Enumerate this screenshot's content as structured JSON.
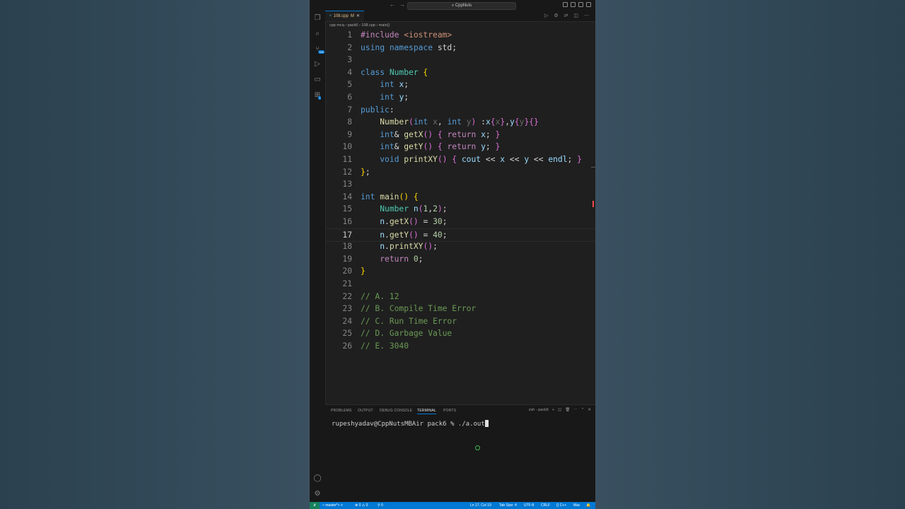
{
  "window": {
    "search_text": "⌕ CppNuts"
  },
  "tab": {
    "filename": "108.cpp",
    "status": "M",
    "close": "✕"
  },
  "breadcrumb": {
    "parts": [
      "cpp mcq",
      "pack6",
      "108.cpp",
      "main()"
    ]
  },
  "editor": {
    "current_line": 17,
    "lines": [
      {
        "num": "1"
      },
      {
        "num": "2"
      },
      {
        "num": "3"
      },
      {
        "num": "4"
      },
      {
        "num": "5"
      },
      {
        "num": "6"
      },
      {
        "num": "7"
      },
      {
        "num": "8"
      },
      {
        "num": "9"
      },
      {
        "num": "10"
      },
      {
        "num": "11"
      },
      {
        "num": "12"
      },
      {
        "num": "13"
      },
      {
        "num": "14"
      },
      {
        "num": "15"
      },
      {
        "num": "16"
      },
      {
        "num": "17"
      },
      {
        "num": "18"
      },
      {
        "num": "19"
      },
      {
        "num": "20"
      },
      {
        "num": "21"
      },
      {
        "num": "22"
      },
      {
        "num": "23"
      },
      {
        "num": "24"
      },
      {
        "num": "25"
      },
      {
        "num": "26"
      }
    ],
    "code": [
      [
        [
          "pre",
          "#include "
        ],
        [
          "s",
          "<iostream>"
        ]
      ],
      [
        [
          "k",
          "using "
        ],
        [
          "k",
          "namespace "
        ],
        [
          "plain",
          "std;"
        ]
      ],
      [],
      [
        [
          "k",
          "class "
        ],
        [
          "t",
          "Number "
        ],
        [
          "b1",
          "{"
        ]
      ],
      [
        [
          "plain",
          "    "
        ],
        [
          "k",
          "int "
        ],
        [
          "v",
          "x"
        ],
        [
          "plain",
          ";"
        ]
      ],
      [
        [
          "plain",
          "    "
        ],
        [
          "k",
          "int "
        ],
        [
          "v",
          "y"
        ],
        [
          "plain",
          ";"
        ]
      ],
      [
        [
          "k",
          "public"
        ],
        [
          "plain",
          ":"
        ]
      ],
      [
        [
          "plain",
          "    "
        ],
        [
          "f",
          "Number"
        ],
        [
          "b2",
          "("
        ],
        [
          "k",
          "int "
        ],
        [
          "dim",
          "x"
        ],
        [
          "plain",
          ", "
        ],
        [
          "k",
          "int "
        ],
        [
          "dim",
          "y"
        ],
        [
          "b2",
          ")"
        ],
        [
          "plain",
          " :"
        ],
        [
          "v",
          "x"
        ],
        [
          "b2",
          "{"
        ],
        [
          "dim",
          "x"
        ],
        [
          "b2",
          "}"
        ],
        [
          "plain",
          ","
        ],
        [
          "v",
          "y"
        ],
        [
          "b2",
          "{"
        ],
        [
          "dim",
          "y"
        ],
        [
          "b2",
          "}{}"
        ]
      ],
      [
        [
          "plain",
          "    "
        ],
        [
          "k",
          "int"
        ],
        [
          "plain",
          "& "
        ],
        [
          "f",
          "getX"
        ],
        [
          "b2",
          "() {"
        ],
        [
          "plain",
          " "
        ],
        [
          "p",
          "return "
        ],
        [
          "v",
          "x"
        ],
        [
          "plain",
          "; "
        ],
        [
          "b2",
          "}"
        ]
      ],
      [
        [
          "plain",
          "    "
        ],
        [
          "k",
          "int"
        ],
        [
          "plain",
          "& "
        ],
        [
          "f",
          "getY"
        ],
        [
          "b2",
          "() {"
        ],
        [
          "plain",
          " "
        ],
        [
          "p",
          "return "
        ],
        [
          "v",
          "y"
        ],
        [
          "plain",
          "; "
        ],
        [
          "b2",
          "}"
        ]
      ],
      [
        [
          "plain",
          "    "
        ],
        [
          "k",
          "void "
        ],
        [
          "f",
          "printXY"
        ],
        [
          "b2",
          "() {"
        ],
        [
          "plain",
          " "
        ],
        [
          "v",
          "cout "
        ],
        [
          "plain",
          "<< "
        ],
        [
          "v",
          "x "
        ],
        [
          "plain",
          "<< "
        ],
        [
          "v",
          "y "
        ],
        [
          "plain",
          "<< "
        ],
        [
          "v",
          "endl"
        ],
        [
          "plain",
          "; "
        ],
        [
          "b2",
          "}"
        ]
      ],
      [
        [
          "b1",
          "}"
        ],
        [
          "plain",
          ";"
        ]
      ],
      [],
      [
        [
          "k",
          "int "
        ],
        [
          "f",
          "main"
        ],
        [
          "b1",
          "() {"
        ]
      ],
      [
        [
          "plain",
          "    "
        ],
        [
          "t",
          "Number "
        ],
        [
          "v",
          "n"
        ],
        [
          "b2",
          "("
        ],
        [
          "n",
          "1"
        ],
        [
          "plain",
          ","
        ],
        [
          "n",
          "2"
        ],
        [
          "b2",
          ")"
        ],
        [
          "plain",
          ";"
        ]
      ],
      [
        [
          "plain",
          "    "
        ],
        [
          "v",
          "n"
        ],
        [
          "plain",
          "."
        ],
        [
          "f",
          "getX"
        ],
        [
          "b2",
          "()"
        ],
        [
          "plain",
          " = "
        ],
        [
          "n",
          "30"
        ],
        [
          "plain",
          ";"
        ]
      ],
      [
        [
          "plain",
          "    "
        ],
        [
          "v",
          "n"
        ],
        [
          "plain",
          "."
        ],
        [
          "f",
          "getY"
        ],
        [
          "b2",
          "()"
        ],
        [
          "plain",
          " = "
        ],
        [
          "n",
          "40"
        ],
        [
          "plain",
          ";"
        ]
      ],
      [
        [
          "plain",
          "    "
        ],
        [
          "v",
          "n"
        ],
        [
          "plain",
          "."
        ],
        [
          "f",
          "printXY"
        ],
        [
          "b2",
          "()"
        ],
        [
          "plain",
          ";"
        ]
      ],
      [
        [
          "plain",
          "    "
        ],
        [
          "p",
          "return "
        ],
        [
          "n",
          "0"
        ],
        [
          "plain",
          ";"
        ]
      ],
      [
        [
          "b1",
          "}"
        ]
      ],
      [],
      [
        [
          "c",
          "// A. 12"
        ]
      ],
      [
        [
          "c",
          "// B. Compile Time Error"
        ]
      ],
      [
        [
          "c",
          "// C. Run Time Error"
        ]
      ],
      [
        [
          "c",
          "// D. Garbage Value"
        ]
      ],
      [
        [
          "c",
          "// E. 3040"
        ]
      ]
    ]
  },
  "panel": {
    "tabs": [
      "PROBLEMS",
      "OUTPUT",
      "DEBUG CONSOLE",
      "TERMINAL",
      "PORTS"
    ],
    "active_tab": "TERMINAL",
    "shell_label": "zsh - pack6",
    "terminal_prompt": "rupeshyadav@CppNutsMBAir pack6 % ./a.out"
  },
  "statusbar": {
    "branch": "master*+",
    "sync": "⟳",
    "problems": "⊗ 0 ⚠ 0",
    "ports": "⚲ 0",
    "position": "Ln 17, Col 19",
    "tab_size": "Tab Size: 4",
    "encoding": "UTF-8",
    "eol": "CRLF",
    "language": "{} C++",
    "platform": "Mac",
    "bell": "🔔"
  },
  "activity_badges": {
    "scm": "108",
    "extensions": "1"
  },
  "colors": {
    "accent": "#0078d4",
    "editor_bg": "#1f1f1f",
    "sidebar_bg": "#181818"
  }
}
